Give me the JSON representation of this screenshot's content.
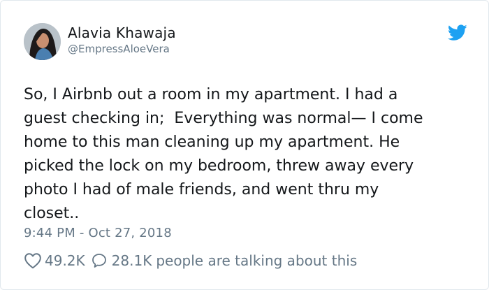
{
  "tweet": {
    "author": {
      "name": "Alavia Khawaja",
      "handle": "@EmpressAloeVera"
    },
    "text": "So, I Airbnb out a room in my apartment. I had a\nguest checking in;  Everything was normal— I come\nhome to this man cleaning up my apartment. He\npicked the lock on my bedroom, threw away every\nphoto I had of male friends, and went thru my\ncloset..",
    "timestamp": "9:44 PM - Oct 27, 2018",
    "likes": "49.2K",
    "replies": "28.1K",
    "talking_label": "people are talking about this"
  },
  "icons": {
    "avatar": "avatar-photo",
    "brand": "twitter-bird-icon",
    "like": "heart-icon",
    "reply": "speech-bubble-icon"
  },
  "colors": {
    "brand": "#1da1f2",
    "text": "#14171a",
    "muted": "#657786",
    "border": "#e1e8ed"
  }
}
